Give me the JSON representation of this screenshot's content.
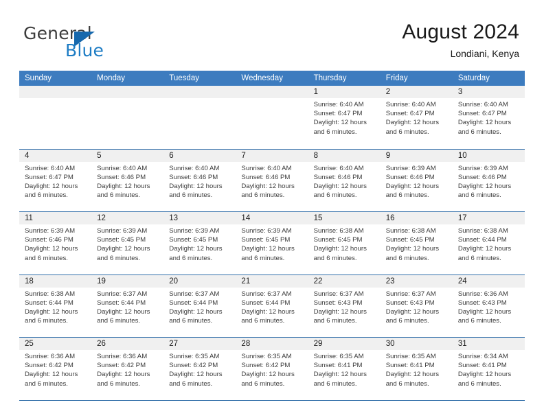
{
  "brand": {
    "name_top": "General",
    "name_bottom": "Blue",
    "flag_icon": "blue-triangle-flag",
    "colors": {
      "blue": "#1d7cc4",
      "flag": "#1668ad",
      "dark": "#3c3c3c"
    }
  },
  "header": {
    "title": "August 2024",
    "subtitle": "Londiani, Kenya"
  },
  "calendar": {
    "accent_color": "#3d7cbf",
    "day_header_bg": "#f0f0f0",
    "weekdays": [
      "Sunday",
      "Monday",
      "Tuesday",
      "Wednesday",
      "Thursday",
      "Friday",
      "Saturday"
    ],
    "weeks": [
      [
        {
          "empty": true
        },
        {
          "empty": true
        },
        {
          "empty": true
        },
        {
          "empty": true
        },
        {
          "day": "1",
          "sunrise": "Sunrise: 6:40 AM",
          "sunset": "Sunset: 6:47 PM",
          "daylight1": "Daylight: 12 hours",
          "daylight2": "and 6 minutes."
        },
        {
          "day": "2",
          "sunrise": "Sunrise: 6:40 AM",
          "sunset": "Sunset: 6:47 PM",
          "daylight1": "Daylight: 12 hours",
          "daylight2": "and 6 minutes."
        },
        {
          "day": "3",
          "sunrise": "Sunrise: 6:40 AM",
          "sunset": "Sunset: 6:47 PM",
          "daylight1": "Daylight: 12 hours",
          "daylight2": "and 6 minutes."
        }
      ],
      [
        {
          "day": "4",
          "sunrise": "Sunrise: 6:40 AM",
          "sunset": "Sunset: 6:47 PM",
          "daylight1": "Daylight: 12 hours",
          "daylight2": "and 6 minutes."
        },
        {
          "day": "5",
          "sunrise": "Sunrise: 6:40 AM",
          "sunset": "Sunset: 6:46 PM",
          "daylight1": "Daylight: 12 hours",
          "daylight2": "and 6 minutes."
        },
        {
          "day": "6",
          "sunrise": "Sunrise: 6:40 AM",
          "sunset": "Sunset: 6:46 PM",
          "daylight1": "Daylight: 12 hours",
          "daylight2": "and 6 minutes."
        },
        {
          "day": "7",
          "sunrise": "Sunrise: 6:40 AM",
          "sunset": "Sunset: 6:46 PM",
          "daylight1": "Daylight: 12 hours",
          "daylight2": "and 6 minutes."
        },
        {
          "day": "8",
          "sunrise": "Sunrise: 6:40 AM",
          "sunset": "Sunset: 6:46 PM",
          "daylight1": "Daylight: 12 hours",
          "daylight2": "and 6 minutes."
        },
        {
          "day": "9",
          "sunrise": "Sunrise: 6:39 AM",
          "sunset": "Sunset: 6:46 PM",
          "daylight1": "Daylight: 12 hours",
          "daylight2": "and 6 minutes."
        },
        {
          "day": "10",
          "sunrise": "Sunrise: 6:39 AM",
          "sunset": "Sunset: 6:46 PM",
          "daylight1": "Daylight: 12 hours",
          "daylight2": "and 6 minutes."
        }
      ],
      [
        {
          "day": "11",
          "sunrise": "Sunrise: 6:39 AM",
          "sunset": "Sunset: 6:46 PM",
          "daylight1": "Daylight: 12 hours",
          "daylight2": "and 6 minutes."
        },
        {
          "day": "12",
          "sunrise": "Sunrise: 6:39 AM",
          "sunset": "Sunset: 6:45 PM",
          "daylight1": "Daylight: 12 hours",
          "daylight2": "and 6 minutes."
        },
        {
          "day": "13",
          "sunrise": "Sunrise: 6:39 AM",
          "sunset": "Sunset: 6:45 PM",
          "daylight1": "Daylight: 12 hours",
          "daylight2": "and 6 minutes."
        },
        {
          "day": "14",
          "sunrise": "Sunrise: 6:39 AM",
          "sunset": "Sunset: 6:45 PM",
          "daylight1": "Daylight: 12 hours",
          "daylight2": "and 6 minutes."
        },
        {
          "day": "15",
          "sunrise": "Sunrise: 6:38 AM",
          "sunset": "Sunset: 6:45 PM",
          "daylight1": "Daylight: 12 hours",
          "daylight2": "and 6 minutes."
        },
        {
          "day": "16",
          "sunrise": "Sunrise: 6:38 AM",
          "sunset": "Sunset: 6:45 PM",
          "daylight1": "Daylight: 12 hours",
          "daylight2": "and 6 minutes."
        },
        {
          "day": "17",
          "sunrise": "Sunrise: 6:38 AM",
          "sunset": "Sunset: 6:44 PM",
          "daylight1": "Daylight: 12 hours",
          "daylight2": "and 6 minutes."
        }
      ],
      [
        {
          "day": "18",
          "sunrise": "Sunrise: 6:38 AM",
          "sunset": "Sunset: 6:44 PM",
          "daylight1": "Daylight: 12 hours",
          "daylight2": "and 6 minutes."
        },
        {
          "day": "19",
          "sunrise": "Sunrise: 6:37 AM",
          "sunset": "Sunset: 6:44 PM",
          "daylight1": "Daylight: 12 hours",
          "daylight2": "and 6 minutes."
        },
        {
          "day": "20",
          "sunrise": "Sunrise: 6:37 AM",
          "sunset": "Sunset: 6:44 PM",
          "daylight1": "Daylight: 12 hours",
          "daylight2": "and 6 minutes."
        },
        {
          "day": "21",
          "sunrise": "Sunrise: 6:37 AM",
          "sunset": "Sunset: 6:44 PM",
          "daylight1": "Daylight: 12 hours",
          "daylight2": "and 6 minutes."
        },
        {
          "day": "22",
          "sunrise": "Sunrise: 6:37 AM",
          "sunset": "Sunset: 6:43 PM",
          "daylight1": "Daylight: 12 hours",
          "daylight2": "and 6 minutes."
        },
        {
          "day": "23",
          "sunrise": "Sunrise: 6:37 AM",
          "sunset": "Sunset: 6:43 PM",
          "daylight1": "Daylight: 12 hours",
          "daylight2": "and 6 minutes."
        },
        {
          "day": "24",
          "sunrise": "Sunrise: 6:36 AM",
          "sunset": "Sunset: 6:43 PM",
          "daylight1": "Daylight: 12 hours",
          "daylight2": "and 6 minutes."
        }
      ],
      [
        {
          "day": "25",
          "sunrise": "Sunrise: 6:36 AM",
          "sunset": "Sunset: 6:42 PM",
          "daylight1": "Daylight: 12 hours",
          "daylight2": "and 6 minutes."
        },
        {
          "day": "26",
          "sunrise": "Sunrise: 6:36 AM",
          "sunset": "Sunset: 6:42 PM",
          "daylight1": "Daylight: 12 hours",
          "daylight2": "and 6 minutes."
        },
        {
          "day": "27",
          "sunrise": "Sunrise: 6:35 AM",
          "sunset": "Sunset: 6:42 PM",
          "daylight1": "Daylight: 12 hours",
          "daylight2": "and 6 minutes."
        },
        {
          "day": "28",
          "sunrise": "Sunrise: 6:35 AM",
          "sunset": "Sunset: 6:42 PM",
          "daylight1": "Daylight: 12 hours",
          "daylight2": "and 6 minutes."
        },
        {
          "day": "29",
          "sunrise": "Sunrise: 6:35 AM",
          "sunset": "Sunset: 6:41 PM",
          "daylight1": "Daylight: 12 hours",
          "daylight2": "and 6 minutes."
        },
        {
          "day": "30",
          "sunrise": "Sunrise: 6:35 AM",
          "sunset": "Sunset: 6:41 PM",
          "daylight1": "Daylight: 12 hours",
          "daylight2": "and 6 minutes."
        },
        {
          "day": "31",
          "sunrise": "Sunrise: 6:34 AM",
          "sunset": "Sunset: 6:41 PM",
          "daylight1": "Daylight: 12 hours",
          "daylight2": "and 6 minutes."
        }
      ]
    ]
  }
}
